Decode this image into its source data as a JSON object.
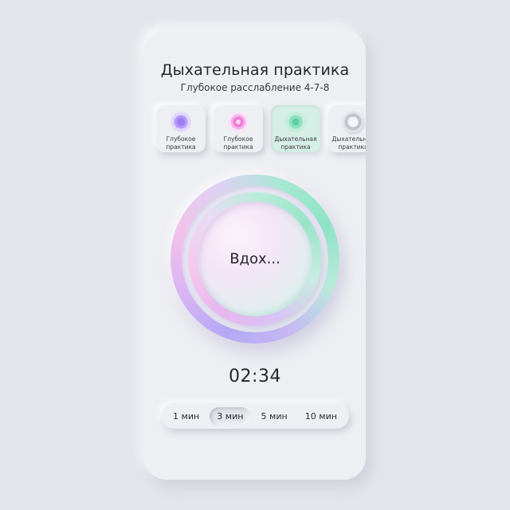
{
  "header": {
    "title": "Дыхательная практика",
    "subtitle": "Глубокое расслабление 4-7-8"
  },
  "practices": [
    {
      "label": "Глубокое\nпрактика",
      "icon": "violet-circle-icon",
      "color": "#9f7cf4",
      "active": false
    },
    {
      "label": "Глубокое\nпрактика",
      "icon": "pink-circle-icon",
      "color": "#ec7ad8",
      "active": false
    },
    {
      "label": "Дыхательная\nпрактика",
      "icon": "mint-circle-icon",
      "color": "#5fcfa4",
      "active": true
    },
    {
      "label": "Дыхательная\nпрактика",
      "icon": "ring-icon",
      "color": "#c2c3cf",
      "active": false
    }
  ],
  "breath": {
    "phase": "Вдох..."
  },
  "timer": {
    "value": "02:34"
  },
  "durations": {
    "options": [
      "1 мин",
      "3 мин",
      "5 мин",
      "10 мин"
    ],
    "selected": "3 мин"
  },
  "colors": {
    "background": "#e4e5ec",
    "surface": "#eeeff3",
    "accent_violet": "#b3a8f4",
    "accent_pink": "#f4c1ea",
    "accent_mint": "#8fe3c5",
    "active_card": "#d6efe6"
  }
}
